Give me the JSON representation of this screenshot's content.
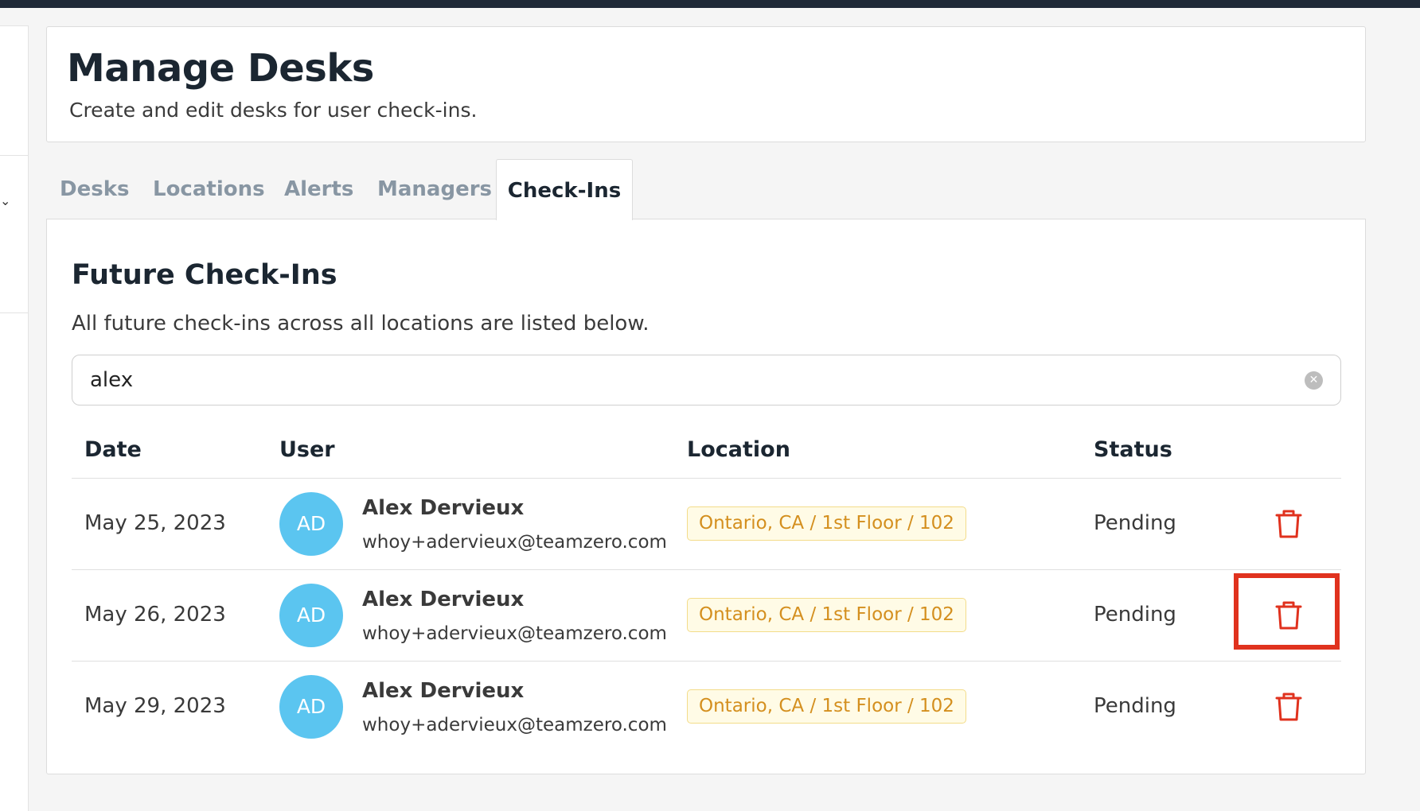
{
  "header": {
    "title": "Manage Desks",
    "subtitle": "Create and edit desks for user check-ins."
  },
  "tabs": [
    {
      "label": "Desks",
      "active": false
    },
    {
      "label": "Locations",
      "active": false
    },
    {
      "label": "Alerts",
      "active": false
    },
    {
      "label": "Managers",
      "active": false
    },
    {
      "label": "Check-Ins",
      "active": true
    }
  ],
  "section": {
    "title": "Future Check-Ins",
    "description": "All future check-ins across all locations are listed below."
  },
  "search": {
    "value": "alex",
    "clear_icon": "circle-x-icon"
  },
  "table": {
    "headers": {
      "date": "Date",
      "user": "User",
      "location": "Location",
      "status": "Status"
    },
    "rows": [
      {
        "date": "May 25, 2023",
        "initials": "AD",
        "name": "Alex Dervieux",
        "email": "whoy+adervieux@teamzero.com",
        "location": "Ontario, CA / 1st Floor / 102",
        "status": "Pending",
        "action_icon": "trash-icon"
      },
      {
        "date": "May 26, 2023",
        "initials": "AD",
        "name": "Alex Dervieux",
        "email": "whoy+adervieux@teamzero.com",
        "location": "Ontario, CA / 1st Floor / 102",
        "status": "Pending",
        "action_icon": "trash-icon"
      },
      {
        "date": "May 29, 2023",
        "initials": "AD",
        "name": "Alex Dervieux",
        "email": "whoy+adervieux@teamzero.com",
        "location": "Ontario, CA / 1st Floor / 102",
        "status": "Pending",
        "action_icon": "trash-icon"
      }
    ]
  },
  "colors": {
    "accent_avatar": "#5bc5f0",
    "location_tag_text": "#d48f1e",
    "location_tag_bg": "#fffbe6",
    "delete_icon": "#e0321e",
    "highlight": "#e0321e"
  }
}
